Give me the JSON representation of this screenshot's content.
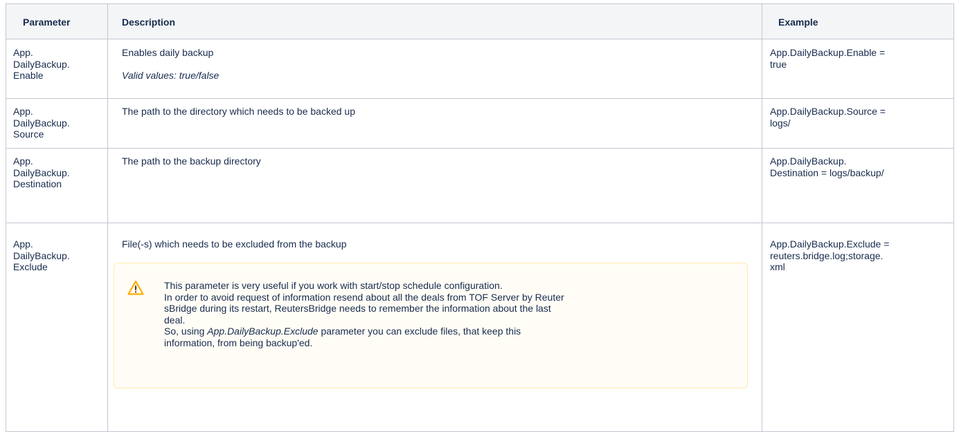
{
  "table": {
    "headers": [
      "Parameter",
      "Description",
      "Example"
    ],
    "rows": [
      {
        "parameter": [
          "App.",
          "DailyBackup.",
          "Enable"
        ],
        "description": "Enables daily backup",
        "description_note": "Valid values: true/false",
        "example": [
          "App.DailyBackup.Enable =",
          "true"
        ]
      },
      {
        "parameter": [
          "App.",
          "DailyBackup.",
          "Source"
        ],
        "description": "The path to the directory which needs to be backed up",
        "example": [
          "App.DailyBackup.Source =",
          "logs/"
        ]
      },
      {
        "parameter": [
          "App.",
          "DailyBackup.",
          "Destination"
        ],
        "description": "The path to the backup directory",
        "example": [
          "App.DailyBackup.",
          "Destination = logs/backup/"
        ]
      },
      {
        "parameter": [
          "App.",
          "DailyBackup.",
          "Exclude"
        ],
        "description": "File(-s) which needs to be excluded from the backup",
        "example": [
          "App.DailyBackup.Exclude =",
          "reuters.bridge.log;storage.",
          "xml"
        ]
      }
    ]
  },
  "warning": {
    "icon": "warning-triangle-icon",
    "line1": "This parameter is very useful if you work with start/stop schedule configuration.",
    "line2": "In order to avoid request of information resend about all the deals from TOF Server by Reuter",
    "line3": "sBridge during its restart, ReutersBridge  needs to remember the information about the last",
    "line4": "deal.",
    "line5_before": "So, using ",
    "line5_italic": "App.DailyBackup.Exclude",
    "line5_after": " parameter you can exclude files, that keep this",
    "line6": "information, from being backup'ed."
  },
  "colors": {
    "border": "#c1c7d0",
    "header_bg": "#f4f5f7",
    "warning_bg": "#fffdf6",
    "warning_border": "#ffeaae",
    "warning_icon": "#ffab00",
    "text": "#172b4d"
  }
}
